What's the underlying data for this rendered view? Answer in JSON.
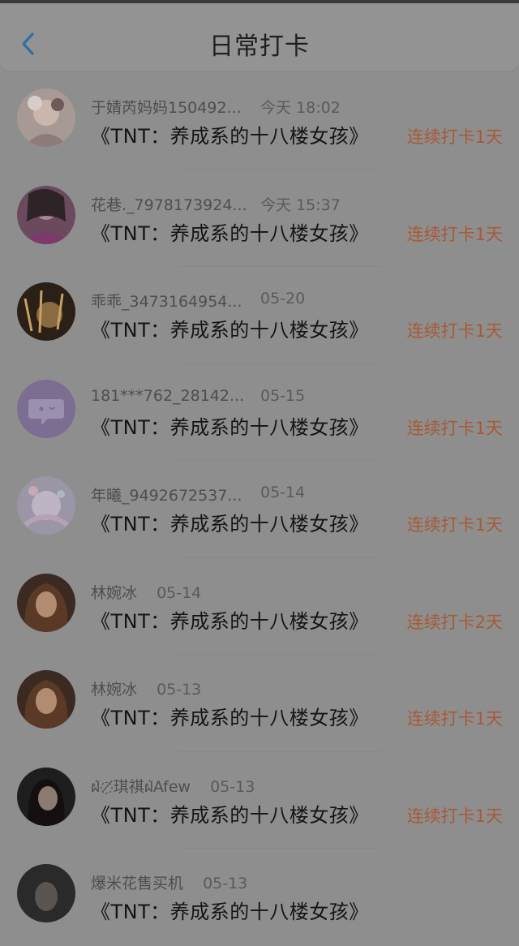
{
  "header": {
    "title": "日常打卡"
  },
  "entries": [
    {
      "user": "于婧芮妈妈150492...",
      "time": "今天 18:02",
      "book": "《TNT：养成系的十八楼女孩》",
      "streak": "连续打卡1天"
    },
    {
      "user": "花巷._7978173924...",
      "time": "今天 15:37",
      "book": "《TNT：养成系的十八楼女孩》",
      "streak": "连续打卡1天"
    },
    {
      "user": "乖乖_3473164954...",
      "time": "05-20",
      "book": "《TNT：养成系的十八楼女孩》",
      "streak": "连续打卡1天"
    },
    {
      "user": "181***762_28142...",
      "time": "05-15",
      "book": "《TNT：养成系的十八楼女孩》",
      "streak": "连续打卡1天"
    },
    {
      "user": "年曦_9492672537...",
      "time": "05-14",
      "book": "《TNT：养成系的十八楼女孩》",
      "streak": "连续打卡1天"
    },
    {
      "user": "林婉冰",
      "time": "05-14",
      "book": "《TNT：养成系的十八楼女孩》",
      "streak": "连续打卡2天"
    },
    {
      "user": "林婉冰",
      "time": "05-13",
      "book": "《TNT：养成系的十八楼女孩》",
      "streak": "连续打卡1天"
    },
    {
      "user": "ฝ่◌̸琪祺ฝ่Afew",
      "time": "05-13",
      "book": "《TNT：养成系的十八楼女孩》",
      "streak": "连续打卡1天"
    },
    {
      "user": "爆米花售买机",
      "time": "05-13",
      "book": "《TNT：养成系的十八楼女孩》",
      "streak": ""
    }
  ],
  "colors": {
    "accent_streak": "#a85a34",
    "back_icon": "#2f6fa8"
  }
}
